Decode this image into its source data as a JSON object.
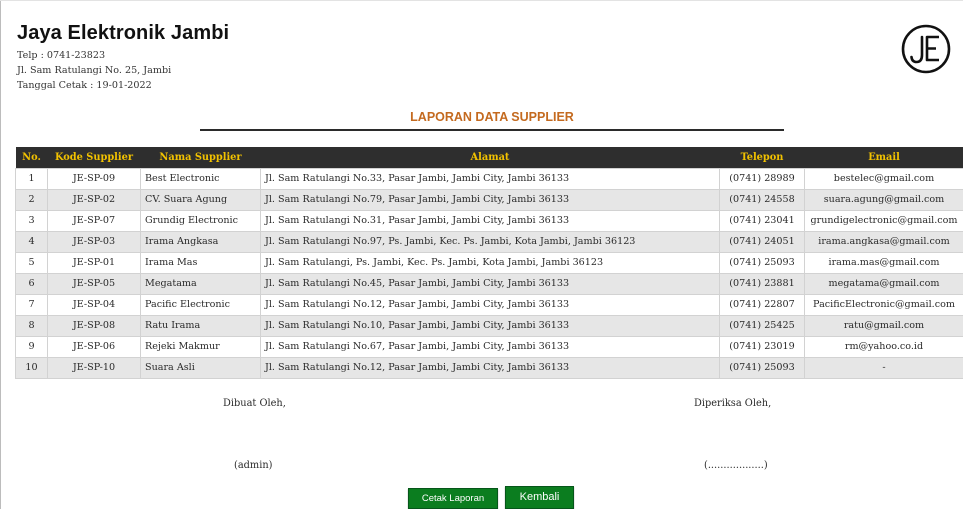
{
  "header": {
    "company_name": "Jaya Elektronik Jambi",
    "phone_line": "Telp : 0741-23823",
    "address_line": "Jl. Sam Ratulangi No. 25, Jambi",
    "print_date_line": "Tanggal Cetak : 19-01-2022",
    "logo_icon": "je-monogram-logo"
  },
  "report": {
    "title": "LAPORAN DATA SUPPLIER",
    "title_color": "#c46a1f"
  },
  "table": {
    "header_bg": "#2e2e2e",
    "header_color": "#f2c200",
    "columns": [
      "No.",
      "Kode Supplier",
      "Nama Supplier",
      "Alamat",
      "Telepon",
      "Email"
    ],
    "rows": [
      [
        "1",
        "JE-SP-09",
        "Best Electronic",
        "Jl. Sam Ratulangi No.33, Pasar Jambi, Jambi City, Jambi 36133",
        "(0741) 28989",
        "bestelec@gmail.com"
      ],
      [
        "2",
        "JE-SP-02",
        "CV. Suara Agung",
        "Jl. Sam Ratulangi No.79, Pasar Jambi, Jambi City, Jambi 36133",
        "(0741) 24558",
        "suara.agung@gmail.com"
      ],
      [
        "3",
        "JE-SP-07",
        "Grundig Electronic",
        "Jl. Sam Ratulangi No.31, Pasar Jambi, Jambi City, Jambi 36133",
        "(0741) 23041",
        "grundigelectronic@gmail.com"
      ],
      [
        "4",
        "JE-SP-03",
        "Irama Angkasa",
        "Jl. Sam Ratulangi No.97, Ps. Jambi, Kec. Ps. Jambi, Kota Jambi, Jambi 36123",
        "(0741) 24051",
        "irama.angkasa@gmail.com"
      ],
      [
        "5",
        "JE-SP-01",
        "Irama Mas",
        "Jl. Sam Ratulangi, Ps. Jambi, Kec. Ps. Jambi, Kota Jambi, Jambi 36123",
        "(0741) 25093",
        "irama.mas@gmail.com"
      ],
      [
        "6",
        "JE-SP-05",
        "Megatama",
        "Jl. Sam Ratulangi No.45, Pasar Jambi, Jambi City, Jambi 36133",
        "(0741) 23881",
        "megatama@gmail.com"
      ],
      [
        "7",
        "JE-SP-04",
        "Pacific Electronic",
        "Jl. Sam Ratulangi No.12, Pasar Jambi, Jambi City, Jambi 36133",
        "(0741) 22807",
        "PacificElectronic@gmail.com"
      ],
      [
        "8",
        "JE-SP-08",
        "Ratu Irama",
        "Jl. Sam Ratulangi No.10, Pasar Jambi, Jambi City, Jambi 36133",
        "(0741) 25425",
        "ratu@gmail.com"
      ],
      [
        "9",
        "JE-SP-06",
        "Rejeki Makmur",
        "Jl. Sam Ratulangi No.67, Pasar Jambi, Jambi City, Jambi 36133",
        "(0741) 23019",
        "rm@yahoo.co.id"
      ],
      [
        "10",
        "JE-SP-10",
        "Suara Asli",
        "Jl. Sam Ratulangi No.12, Pasar Jambi, Jambi City, Jambi 36133",
        "(0741) 25093",
        "-"
      ]
    ]
  },
  "signatures": {
    "made_by_label": "Dibuat Oleh,",
    "checked_by_label": "Diperiksa Oleh,",
    "made_by_name": "(admin)",
    "checked_by_name": "(..................)"
  },
  "actions": {
    "print_label": "Cetak Laporan",
    "back_label": "Kembali",
    "button_color": "#0b7d1f"
  }
}
